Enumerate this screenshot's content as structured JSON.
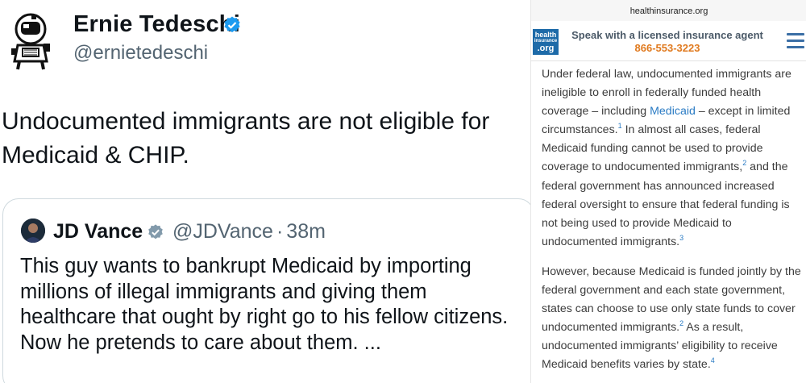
{
  "tweet": {
    "author_name": "Ernie Tedeschi",
    "author_handle": "@ernietedeschi",
    "text": "Undocumented immigrants are not eligible for Medicaid & CHIP.",
    "quote": {
      "author_name": "JD Vance",
      "author_handle": "@JDVance",
      "separator": "·",
      "time": "38m",
      "text": "This guy wants to bankrupt Medicaid by importing millions of illegal immigrants and giving them healthcare that ought by right go to his fellow citizens. Now he pretends to care about them. ..."
    },
    "verified_color": "#1d9bf0"
  },
  "webpage": {
    "url": "healthinsurance.org",
    "logo": {
      "line1": "health",
      "line2": "insurance",
      "line3": ".org"
    },
    "cta_text": "Speak with a licensed insurance agent",
    "cta_phone": "866-553-3223",
    "paragraph1": {
      "part1": "Under federal law, undocumented immigrants are ineligible to enroll in federally funded health coverage – including ",
      "link": "Medicaid",
      "part2": " – except in limited circumstances.",
      "sup1": "1",
      "part3": " In almost all cases, federal Medicaid funding cannot be used to provide coverage to undocumented immigrants,",
      "sup2": "2",
      "part4": " and the federal government has announced increased federal oversight to ensure that federal funding is not being used to provide Medicaid to undocumented immigrants.",
      "sup3": "3"
    },
    "paragraph2": {
      "part1": "However, because Medicaid is funded jointly by the federal government and each state government, states can choose to use only state funds to cover undocumented immigrants.",
      "sup1": "2",
      "part2": " As a result, undocumented immigrants’ eligibility to receive Medicaid benefits varies by state.",
      "sup2": "4"
    },
    "colors": {
      "brand": "#1d6aa8",
      "phone": "#e07a1f",
      "link": "#2a7bc4"
    }
  }
}
